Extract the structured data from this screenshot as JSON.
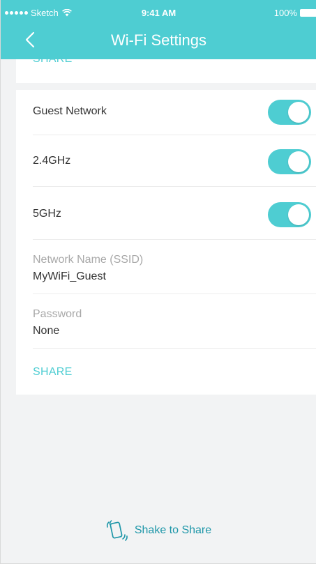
{
  "status_bar": {
    "carrier": "Sketch",
    "time": "9:41 AM",
    "battery": "100%"
  },
  "header": {
    "title": "Wi-Fi Settings",
    "back_icon": "chevron-left-icon"
  },
  "top_card": {
    "share_label": "SHARE"
  },
  "guest_card": {
    "guest_network": {
      "label": "Guest Network",
      "enabled": true
    },
    "band_24": {
      "label": "2.4GHz",
      "enabled": true
    },
    "band_5": {
      "label": "5GHz",
      "enabled": true
    },
    "ssid": {
      "label": "Network Name (SSID)",
      "value": "MyWiFi_Guest"
    },
    "password": {
      "label": "Password",
      "value": "None"
    },
    "share_label": "SHARE"
  },
  "shake": {
    "label": "Shake to Share",
    "icon": "shake-phone-icon"
  },
  "colors": {
    "accent": "#4ecdd2",
    "shake_text": "#1d96a8",
    "background": "#f2f3f4"
  }
}
